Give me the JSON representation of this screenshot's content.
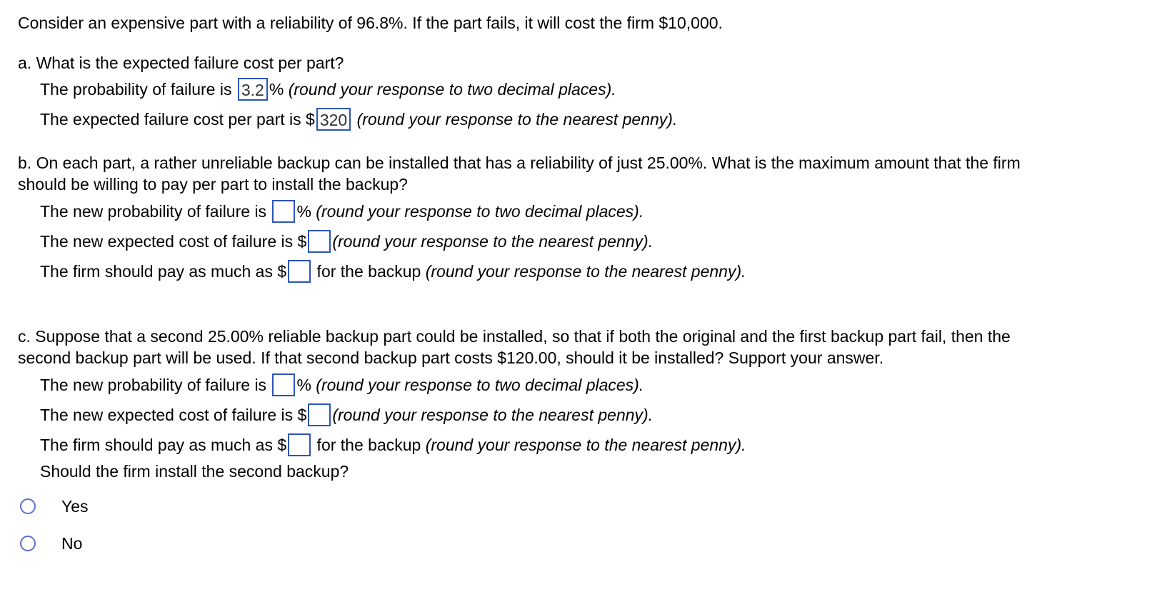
{
  "intro": "Consider an expensive part with a reliability of 96.8%.  If the part fails, it will cost the firm $10,000.",
  "a": {
    "question": "a. What is the expected failure cost per part?",
    "l1_pre": "The probability of failure is ",
    "l1_val": "3.2",
    "l1_post": "% ",
    "l1_hint": "(round your response to two decimal places).",
    "l2_pre": "The expected failure cost per part is $",
    "l2_val": "320",
    "l2_hint": "(round your response to the nearest penny)."
  },
  "b": {
    "q1": "b. On each part, a rather unreliable backup can be installed that has a reliability of just 25.00%. What is the maximum amount that the firm",
    "q2": "should be willing to pay per part to install the backup?",
    "l1_pre": "The new probability of failure is ",
    "l1_post": "% ",
    "l1_hint": "(round your response to two decimal places).",
    "l2_pre": "The new expected cost of failure is $",
    "l2_hint": "(round your response to the nearest penny).",
    "l3_pre": "The firm should pay as much as $",
    "l3_mid": " for the backup ",
    "l3_hint": "(round your response to the nearest penny)."
  },
  "c": {
    "q1": "c. Suppose that a second 25.00% reliable backup part could be installed, so that if both the original and the first backup part fail, then the",
    "q2": "second backup part will be used. If that second backup part costs $120.00, should it be installed? Support your answer.",
    "l1_pre": "The new probability of failure is ",
    "l1_post": "% ",
    "l1_hint": "(round your response to two decimal places).",
    "l2_pre": "The new expected cost of failure is $",
    "l2_hint": "(round your response to the nearest penny).",
    "l3_pre": "The firm should pay as much as $",
    "l3_mid": " for the backup ",
    "l3_hint": "(round your response to the nearest penny).",
    "l4": "Should the firm install the second backup?",
    "options": [
      "Yes",
      "No"
    ]
  }
}
